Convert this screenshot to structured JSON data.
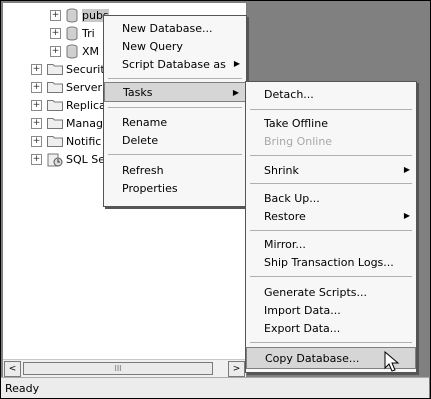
{
  "tree": {
    "nodes": [
      {
        "label": "pubs",
        "icon": "database-icon",
        "expand": "+"
      },
      {
        "label": "Tri",
        "icon": "database-icon",
        "expand": "+"
      },
      {
        "label": "XM",
        "icon": "database-icon",
        "expand": "+"
      },
      {
        "label": "Securit",
        "icon": "folder-icon",
        "expand": "+"
      },
      {
        "label": "Server",
        "icon": "folder-icon",
        "expand": "+"
      },
      {
        "label": "Replica",
        "icon": "folder-icon",
        "expand": "+"
      },
      {
        "label": "Manag",
        "icon": "folder-icon",
        "expand": "+"
      },
      {
        "label": "Notific",
        "icon": "folder-icon",
        "expand": "+"
      },
      {
        "label": "SQL Se",
        "icon": "agent-icon",
        "expand": "+"
      }
    ]
  },
  "scrollbar": {
    "thumb_grip": "III",
    "left_arrow": "<",
    "right_arrow": ">"
  },
  "status_bar": {
    "text": "Ready"
  },
  "context_menu": {
    "items": [
      {
        "label": "New Database..."
      },
      {
        "label": "New Query"
      },
      {
        "label": "Script Database as",
        "submenu": true
      },
      {
        "label": "Tasks",
        "submenu": true,
        "highlighted": true
      },
      {
        "label": "Rename"
      },
      {
        "label": "Delete"
      },
      {
        "label": "Refresh"
      },
      {
        "label": "Properties"
      }
    ]
  },
  "tasks_submenu": {
    "items": [
      {
        "label": "Detach..."
      },
      {
        "label": "Take Offline"
      },
      {
        "label": "Bring Online",
        "disabled": true
      },
      {
        "label": "Shrink",
        "submenu": true
      },
      {
        "label": "Back Up..."
      },
      {
        "label": "Restore",
        "submenu": true
      },
      {
        "label": "Mirror..."
      },
      {
        "label": "Ship Transaction Logs..."
      },
      {
        "label": "Generate Scripts..."
      },
      {
        "label": "Import Data..."
      },
      {
        "label": "Export Data..."
      },
      {
        "label": "Copy Database...",
        "highlighted": true
      }
    ]
  },
  "icons": {
    "submenu_arrow": "▶"
  }
}
